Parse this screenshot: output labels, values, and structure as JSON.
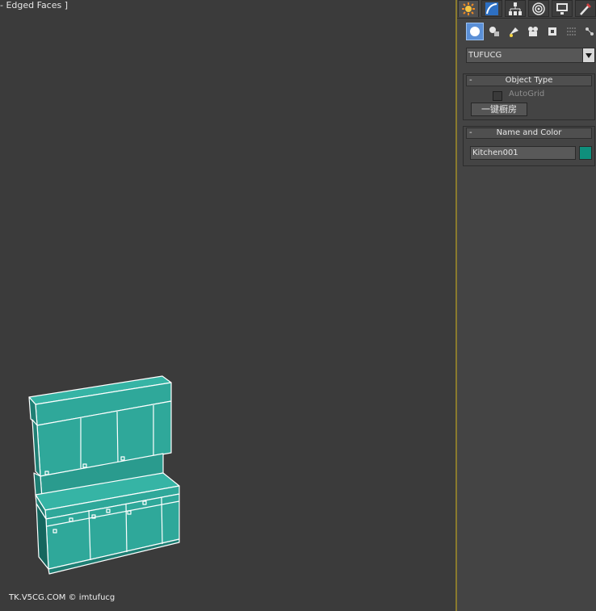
{
  "viewport": {
    "label": "- Edged Faces ]",
    "watermark": "TK.V5CG.COM © imtufucg",
    "model_color": "#2fa89a",
    "model_edge_color": "#ffffff"
  },
  "panel": {
    "tabs": [
      {
        "icon": "create-icon",
        "active": true
      },
      {
        "icon": "modify-icon",
        "active": false
      },
      {
        "icon": "hierarchy-icon",
        "active": false
      },
      {
        "icon": "motion-icon",
        "active": false
      },
      {
        "icon": "display-icon",
        "active": false
      },
      {
        "icon": "utilities-icon",
        "active": false
      }
    ],
    "subicons": [
      {
        "icon": "geometry-icon",
        "active": true
      },
      {
        "icon": "shapes-icon",
        "active": false
      },
      {
        "icon": "lights-icon",
        "active": false
      },
      {
        "icon": "cameras-icon",
        "active": false
      },
      {
        "icon": "helpers-icon",
        "active": false
      },
      {
        "icon": "spacewarps-icon",
        "active": false
      },
      {
        "icon": "systems-icon",
        "active": false
      }
    ],
    "category": "TUFUCG",
    "object_type": {
      "title": "Object Type",
      "minus": "-",
      "autogrid_label": "AutoGrid",
      "autogrid_checked": false,
      "button_label": "一键橱房"
    },
    "name_and_color": {
      "title": "Name and Color",
      "minus": "-",
      "name_value": "Kitchen001",
      "color": "#0f8f7c"
    }
  }
}
